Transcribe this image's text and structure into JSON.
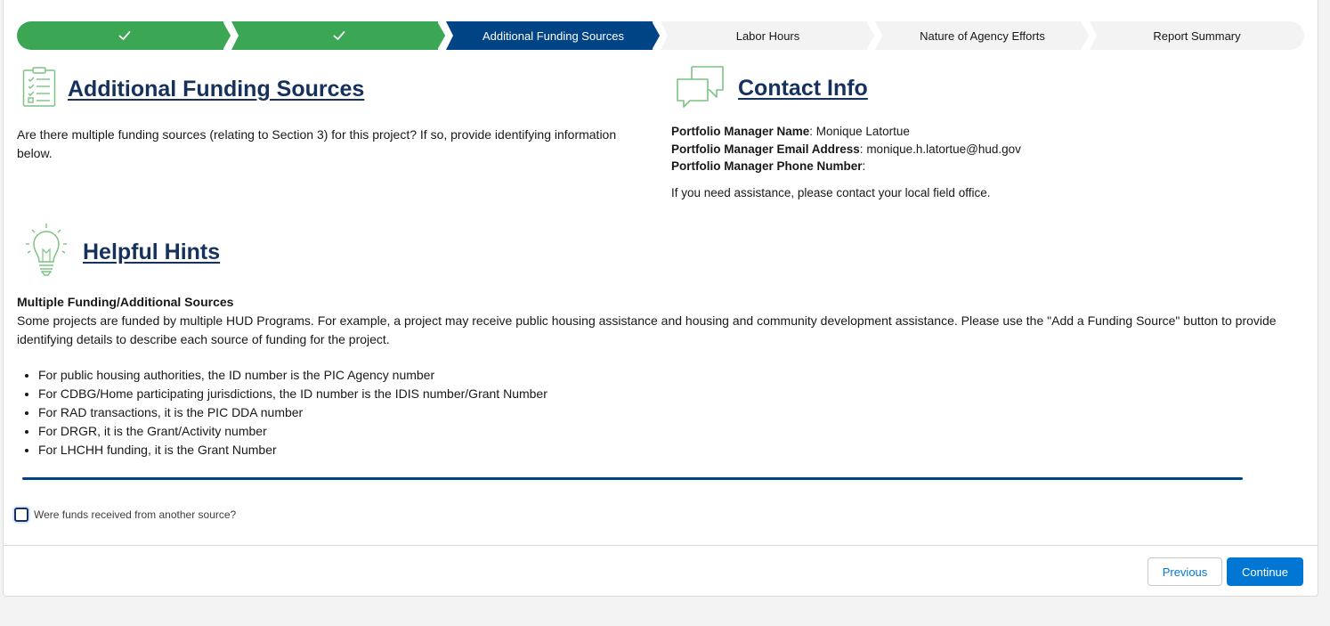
{
  "progress": {
    "steps": [
      {
        "label": "",
        "state": "complete"
      },
      {
        "label": "",
        "state": "complete"
      },
      {
        "label": "Additional Funding Sources",
        "state": "current"
      },
      {
        "label": "Labor Hours",
        "state": "incomplete"
      },
      {
        "label": "Nature of Agency Efforts",
        "state": "incomplete"
      },
      {
        "label": "Report Summary",
        "state": "incomplete"
      }
    ]
  },
  "funding": {
    "title": "Additional Funding Sources",
    "description": "Are there multiple funding sources (relating to Section 3) for this project? If so, provide identifying information below."
  },
  "contact": {
    "title": "Contact Info",
    "name_label": "Portfolio Manager Name",
    "name_value": "Monique Latortue",
    "email_label": "Portfolio Manager Email Address",
    "email_value": "monique.h.latortue@hud.gov",
    "phone_label": "Portfolio Manager Phone Number",
    "phone_value": "",
    "assist_text": "If you need assistance, please contact your local field office."
  },
  "hints": {
    "title": "Helpful Hints",
    "heading": "Multiple Funding/Additional Sources",
    "body": "Some projects are funded by multiple HUD Programs. For example, a project may receive public housing assistance and housing and community development assistance. Please use the \"Add a Funding Source\" button to provide identifying details to describe each source of funding for the project.",
    "items": [
      "For public housing authorities, the ID number is the PIC Agency number",
      "For CDBG/Home participating jurisdictions, the ID number is the IDIS number/Grant Number",
      "For RAD transactions, it is the PIC DDA number",
      "For DRGR, it is the Grant/Activity number",
      "For LHCHH funding, it is the Grant Number"
    ]
  },
  "other_source": {
    "label": "Were funds received from another source?",
    "checked": false
  },
  "footer": {
    "previous_label": "Previous",
    "continue_label": "Continue"
  },
  "colors": {
    "complete": "#3ba755",
    "current": "#014486",
    "incomplete": "#f3f3f3",
    "brand": "#0176d3",
    "title": "#16325c",
    "icon_green": "#7cc382"
  }
}
